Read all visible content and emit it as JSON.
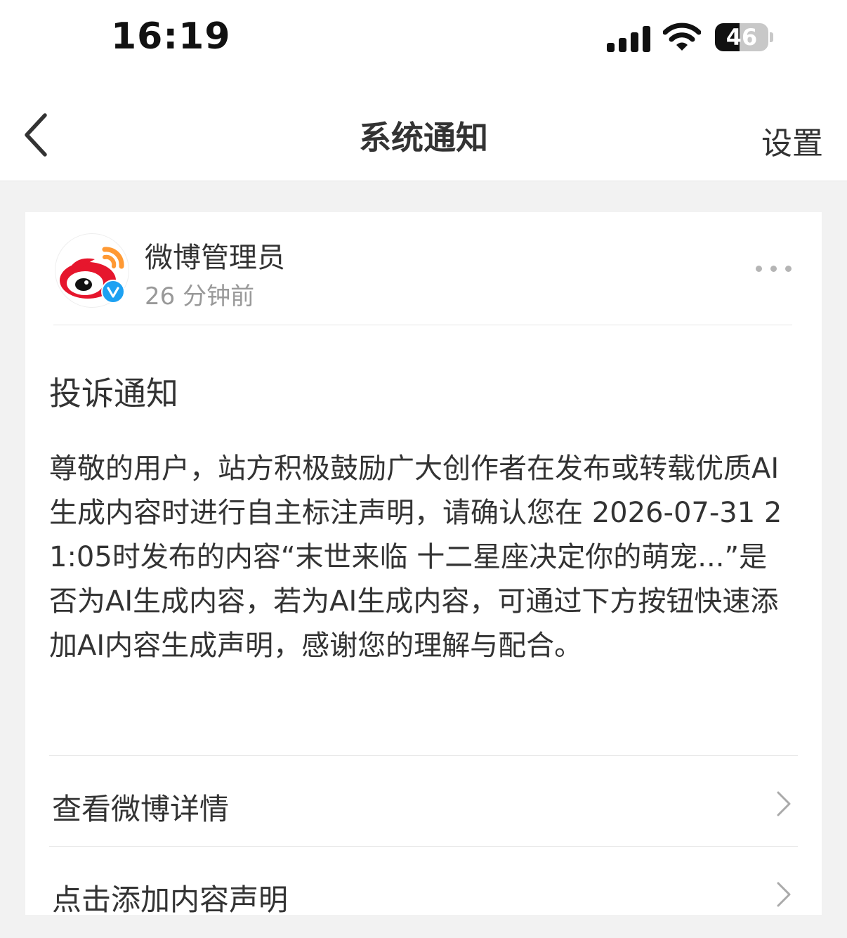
{
  "status_bar": {
    "time": "16:19",
    "battery_percent": "46",
    "battery_level": 0.46
  },
  "nav": {
    "title": "系统通知",
    "settings_label": "设置"
  },
  "message": {
    "sender": "微博管理员",
    "time_ago": "26 分钟前",
    "title": "投诉通知",
    "body": "尊敬的用户，站方积极鼓励广大创作者在发布或转载优质AI生成内容时进行自主标注声明，请确认您在 2026-07-31 21:05时发布的内容“末世来临 十二星座决定你的萌宠...”是否为AI生成内容，若为AI生成内容，可通过下方按钮快速添加AI内容生成声明，感谢您的理解与配合。",
    "actions": [
      {
        "label": "查看微博详情"
      },
      {
        "label": "点击添加内容声明"
      }
    ]
  },
  "colors": {
    "weibo_red": "#e6162d",
    "weibo_orange": "#ff9933",
    "verified_blue": "#1da1f2",
    "text_primary": "#333333",
    "text_secondary": "#999999"
  }
}
